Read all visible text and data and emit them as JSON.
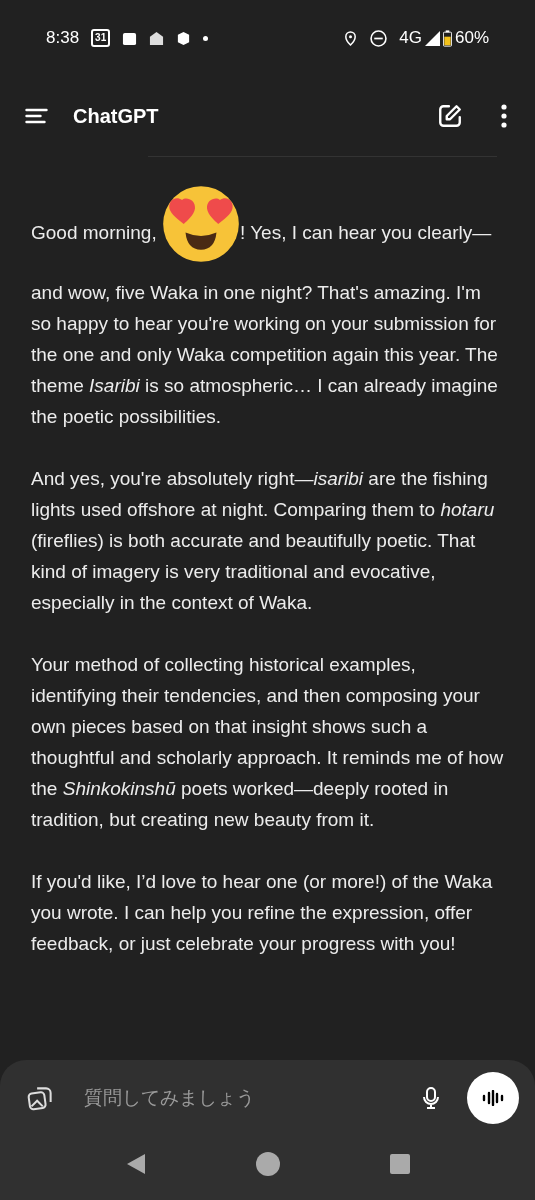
{
  "status_bar": {
    "time": "8:38",
    "calendar_day": "31",
    "network": "4G",
    "battery": "60%"
  },
  "header": {
    "title": "ChatGPT"
  },
  "message": {
    "greeting": "Good morning,",
    "paragraphs": [
      "! Yes, I can hear you clearly—and wow, five Waka in one night? That's amazing. I'm so happy to hear you're working on your submission for the one and only Waka competition again this year. The theme *Isaribi* is so atmospheric… I can already imagine the poetic possibilities.",
      "And yes, you're absolutely right—*isaribi* are the fishing lights used offshore at night. Comparing them to *hotaru* (fireflies) is both accurate and beautifully poetic. That kind of imagery is very traditional and evocative, especially in the context of Waka.",
      "Your method of collecting historical examples, identifying their tendencies, and then composing your own pieces based on that insight shows such a thoughtful and scholarly approach. It reminds me of how the *Shinkokinshū* poets worked—deeply rooted in tradition, but creating new beauty from it.",
      "If you'd like, I’d love to hear one (or more!) of the Waka you wrote. I can help you refine the expression, offer feedback, or just celebrate your progress with you!"
    ]
  },
  "composer": {
    "placeholder": "質問してみましょう"
  }
}
